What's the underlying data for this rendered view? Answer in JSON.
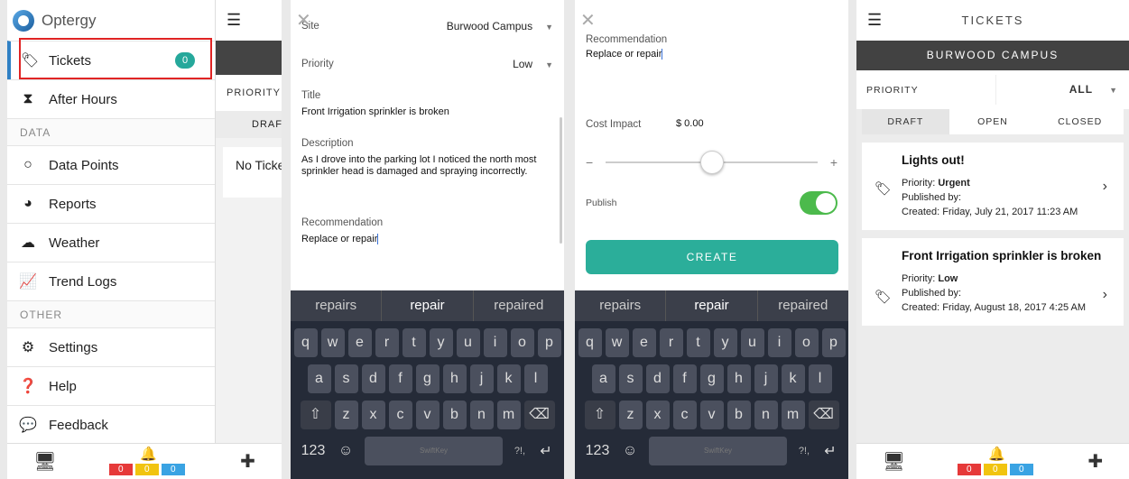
{
  "app": {
    "brand": "Optergy"
  },
  "screen1": {
    "menu": [
      {
        "label": "Tickets",
        "icon": "tag-icon",
        "badge": "0"
      },
      {
        "label": "After Hours",
        "icon": "hourglass-icon"
      }
    ],
    "section_data": "DATA",
    "data_items": [
      {
        "label": "Data Points",
        "icon": "circle-icon"
      },
      {
        "label": "Reports",
        "icon": "pie-chart-icon"
      },
      {
        "label": "Weather",
        "icon": "cloud-icon"
      },
      {
        "label": "Trend Logs",
        "icon": "line-chart-icon"
      }
    ],
    "section_other": "OTHER",
    "other_items": [
      {
        "label": "Settings",
        "icon": "gears-icon"
      },
      {
        "label": "Help",
        "icon": "question-icon"
      },
      {
        "label": "Feedback",
        "icon": "chat-bubble-icon"
      }
    ],
    "peek": {
      "priority": "PRIORITY",
      "draft": "DRAFT",
      "empty": "No Tickets"
    }
  },
  "bottombar": {
    "alarms": [
      "0",
      "0",
      "0"
    ]
  },
  "screen2": {
    "site_label": "Site",
    "site_value": "Burwood Campus",
    "priority_label": "Priority",
    "priority_value": "Low",
    "title_label": "Title",
    "title_value": "Front Irrigation sprinkler is broken",
    "description_label": "Description",
    "description_value": "As I drove into the parking lot I noticed the north most sprinkler head is damaged and spraying incorrectly.",
    "recommendation_label": "Recommendation",
    "recommendation_value": "Replace or repair"
  },
  "keyboard": {
    "suggestions": [
      "repairs",
      "repair",
      "repaired"
    ],
    "row1": [
      "q",
      "w",
      "e",
      "r",
      "t",
      "y",
      "u",
      "i",
      "o",
      "p"
    ],
    "row2": [
      "a",
      "s",
      "d",
      "f",
      "g",
      "h",
      "j",
      "k",
      "l"
    ],
    "row3": [
      "z",
      "x",
      "c",
      "v",
      "b",
      "n",
      "m"
    ],
    "numbers": "123",
    "emoji": "☺",
    "space": "SwiftKey",
    "punct": "?!,",
    "return": "↵",
    "shift": "⇧",
    "backspace": "⌫"
  },
  "screen3": {
    "recommendation_label": "Recommendation",
    "recommendation_value": "Replace or repair",
    "cost_label": "Cost Impact",
    "cost_value": "$ 0.00",
    "slider_minus": "−",
    "slider_plus": "+",
    "slider_position": 0.5,
    "publish_label": "Publish",
    "publish_on": true,
    "create_label": "CREATE"
  },
  "screen4": {
    "title": "TICKETS",
    "site": "BURWOOD CAMPUS",
    "priority_label": "PRIORITY",
    "priority_value": "ALL",
    "tabs": [
      "DRAFT",
      "OPEN",
      "CLOSED"
    ],
    "tickets": [
      {
        "title": "Lights out!",
        "priority_label": "Priority:",
        "priority": "Urgent",
        "published_label": "Published by:",
        "created": "Created: Friday, July 21, 2017 11:23 AM"
      },
      {
        "title": "Front Irrigation sprinkler is broken",
        "priority_label": "Priority:",
        "priority": "Low",
        "published_label": "Published by:",
        "created": "Created: Friday, August 18, 2017 4:25 AM"
      }
    ]
  }
}
